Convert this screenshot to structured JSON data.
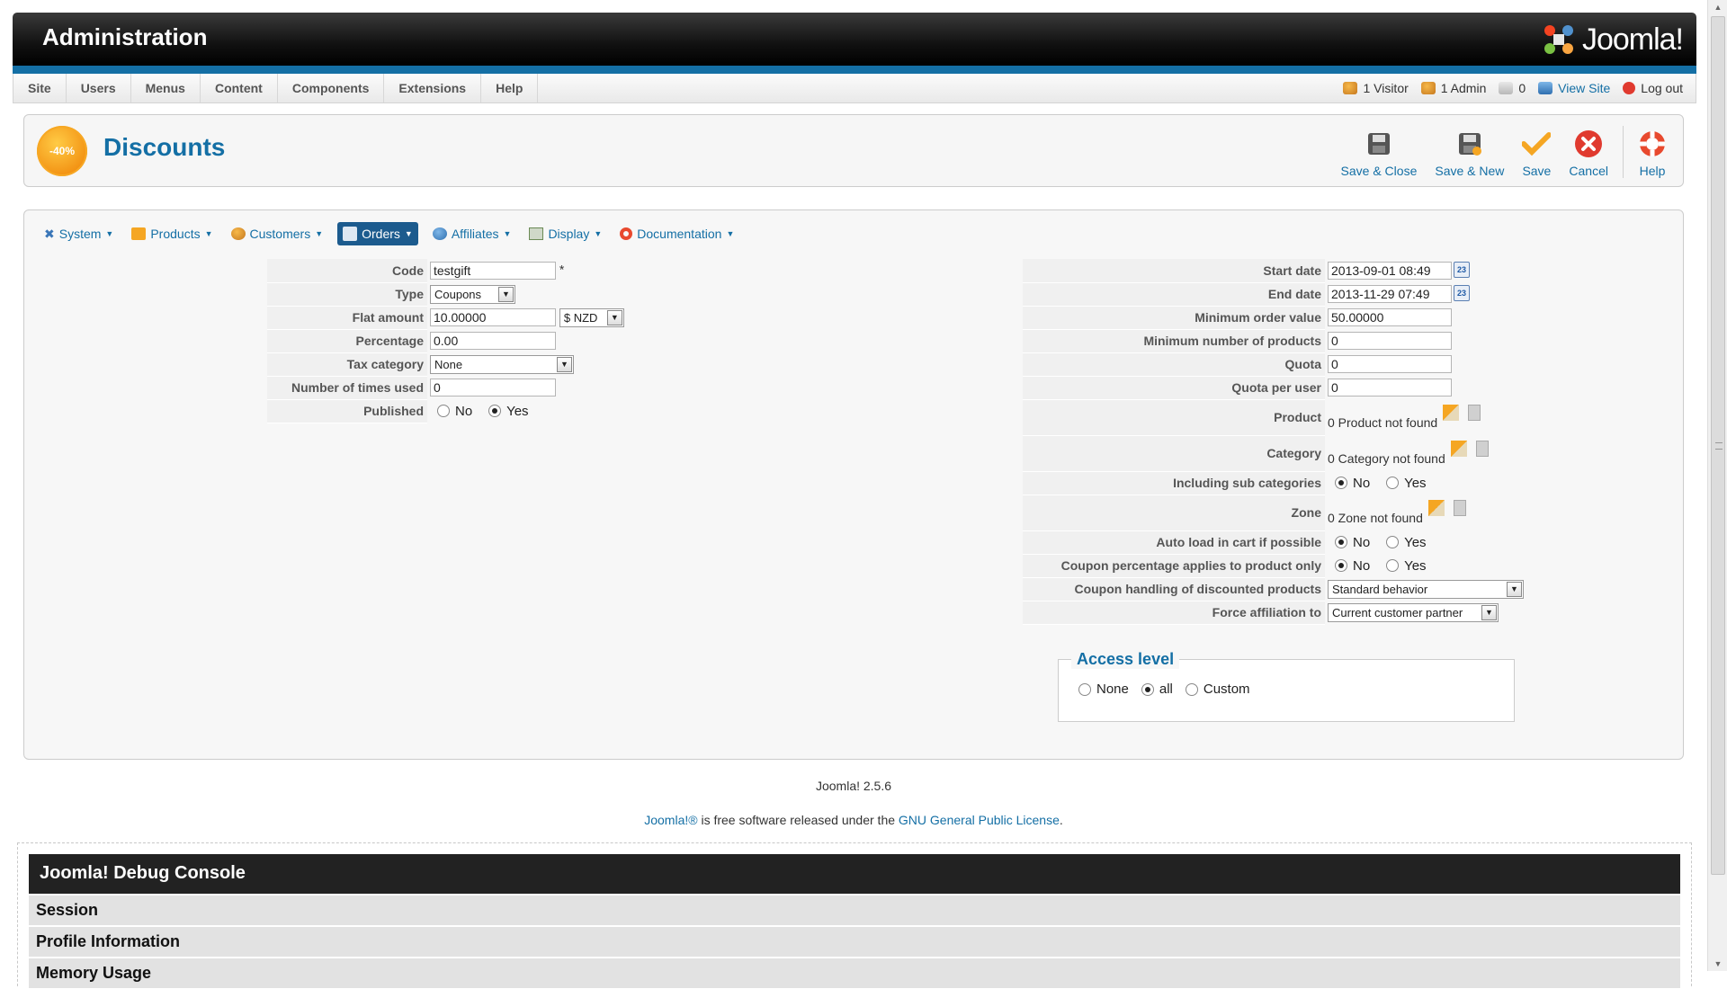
{
  "header": {
    "title": "Administration",
    "logo_text": "Joomla!"
  },
  "menubar": {
    "items": [
      "Site",
      "Users",
      "Menus",
      "Content",
      "Components",
      "Extensions",
      "Help"
    ],
    "status": {
      "visitors": "1 Visitor",
      "admins": "1 Admin",
      "messages": "0",
      "view_site": "View Site",
      "logout": "Log out"
    }
  },
  "toolbar": {
    "badge": "-40%",
    "title": "Discounts",
    "buttons": {
      "save_close": "Save & Close",
      "save_new": "Save & New",
      "save": "Save",
      "cancel": "Cancel",
      "help": "Help"
    }
  },
  "submenu": {
    "items": [
      "System",
      "Products",
      "Customers",
      "Orders",
      "Affiliates",
      "Display",
      "Documentation"
    ],
    "active": "Orders"
  },
  "left_form": {
    "code": {
      "label": "Code",
      "value": "testgift",
      "required_mark": "*"
    },
    "type": {
      "label": "Type",
      "value": "Coupons"
    },
    "flat_amount": {
      "label": "Flat amount",
      "value": "10.00000",
      "currency": "$ NZD"
    },
    "percentage": {
      "label": "Percentage",
      "value": "0.00"
    },
    "tax_category": {
      "label": "Tax category",
      "value": "None"
    },
    "times_used": {
      "label": "Number of times used",
      "value": "0"
    },
    "published": {
      "label": "Published",
      "no": "No",
      "yes": "Yes",
      "selected": "Yes"
    }
  },
  "right_form": {
    "start_date": {
      "label": "Start date",
      "value": "2013-09-01 08:49",
      "cal": "23"
    },
    "end_date": {
      "label": "End date",
      "value": "2013-11-29 07:49",
      "cal": "23"
    },
    "min_order": {
      "label": "Minimum order value",
      "value": "50.00000"
    },
    "min_products": {
      "label": "Minimum number of products",
      "value": "0"
    },
    "quota": {
      "label": "Quota",
      "value": "0"
    },
    "quota_user": {
      "label": "Quota per user",
      "value": "0"
    },
    "product": {
      "label": "Product",
      "value": "0 Product not found"
    },
    "category": {
      "label": "Category",
      "value": "0 Category not found"
    },
    "sub_categories": {
      "label": "Including sub categories",
      "no": "No",
      "yes": "Yes",
      "selected": "No"
    },
    "zone": {
      "label": "Zone",
      "value": "0 Zone not found"
    },
    "auto_load": {
      "label": "Auto load in cart if possible",
      "no": "No",
      "yes": "Yes",
      "selected": "No"
    },
    "coupon_pct_product": {
      "label": "Coupon percentage applies to product only",
      "no": "No",
      "yes": "Yes",
      "selected": "No"
    },
    "coupon_handling": {
      "label": "Coupon handling of discounted products",
      "value": "Standard behavior"
    },
    "force_affiliation": {
      "label": "Force affiliation to",
      "value": "Current customer partner"
    }
  },
  "access": {
    "legend": "Access level",
    "none": "None",
    "all": "all",
    "custom": "Custom",
    "selected": "all"
  },
  "footer": {
    "version": "Joomla! 2.5.6",
    "license_link1": "Joomla!®",
    "license_mid": " is free software released under the ",
    "license_link2": "GNU General Public License",
    "license_end": "."
  },
  "debug": {
    "title": "Joomla! Debug Console",
    "sections": [
      "Session",
      "Profile Information",
      "Memory Usage"
    ]
  },
  "colors": {
    "accent": "#146fa5",
    "header_bg": "#111111",
    "active_submenu": "#1c5b8e",
    "badge": "#f39415",
    "cancel_red": "#e03a2f"
  }
}
